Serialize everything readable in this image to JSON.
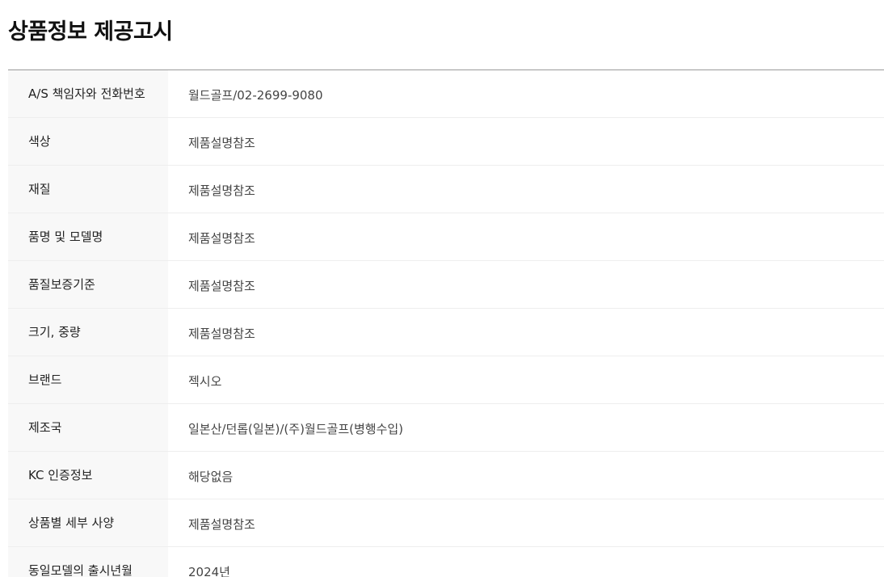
{
  "section": {
    "title": "상품정보 제공고시"
  },
  "rows": [
    {
      "label": "A/S 책임자와 전화번호",
      "value": "월드골프/02-2699-9080"
    },
    {
      "label": "색상",
      "value": "제품설명참조"
    },
    {
      "label": "재질",
      "value": "제품설명참조"
    },
    {
      "label": "품명 및 모델명",
      "value": "제품설명참조"
    },
    {
      "label": "품질보증기준",
      "value": "제품설명참조"
    },
    {
      "label": "크기, 중량",
      "value": "제품설명참조"
    },
    {
      "label": "브랜드",
      "value": "젝시오"
    },
    {
      "label": "제조국",
      "value": "일본산/던롭(일본)/(주)월드골프(병행수입)"
    },
    {
      "label": "KC 인증정보",
      "value": "해당없음"
    },
    {
      "label": "상품별 세부 사양",
      "value": "제품설명참조"
    },
    {
      "label": "동일모델의 출시년월",
      "value": "2024년"
    }
  ]
}
